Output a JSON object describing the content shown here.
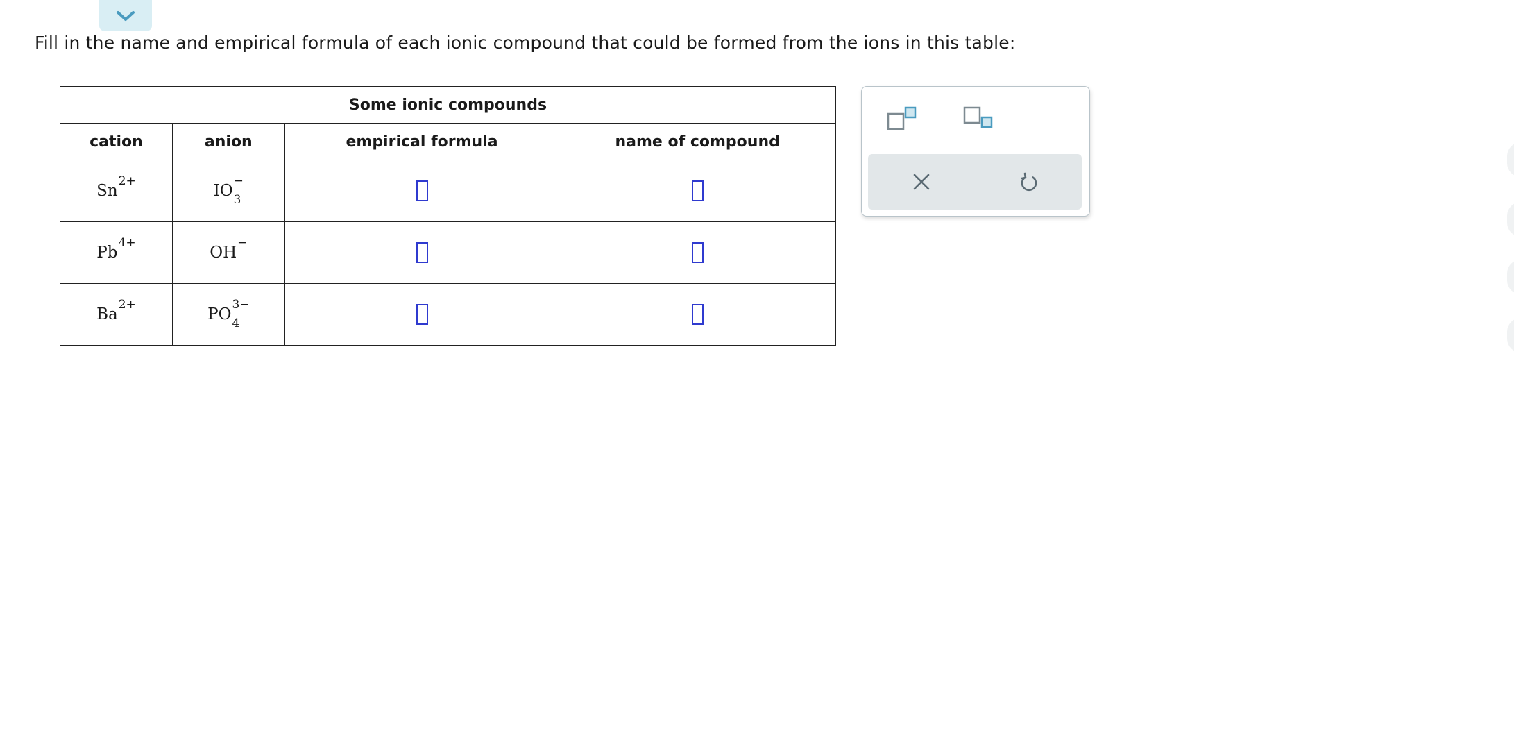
{
  "prompt": "Fill in the name and empirical formula of each ionic compound that could be formed from the ions in this table:",
  "table": {
    "caption": "Some ionic compounds",
    "headers": {
      "cation": "cation",
      "anion": "anion",
      "formula": "empirical formula",
      "name": "name of compound"
    },
    "rows": [
      {
        "cation": {
          "symbol": "Sn",
          "charge": "2+",
          "subscript": ""
        },
        "anion": {
          "symbol": "IO",
          "charge": "−",
          "subscript": "3"
        },
        "formula": "",
        "name": ""
      },
      {
        "cation": {
          "symbol": "Pb",
          "charge": "4+",
          "subscript": ""
        },
        "anion": {
          "symbol": "OH",
          "charge": "−",
          "subscript": ""
        },
        "formula": "",
        "name": ""
      },
      {
        "cation": {
          "symbol": "Ba",
          "charge": "2+",
          "subscript": ""
        },
        "anion": {
          "symbol": "PO",
          "charge": "3−",
          "subscript": "4"
        },
        "formula": "",
        "name": ""
      }
    ]
  },
  "toolbar": {
    "superscript_icon": "superscript-template-icon",
    "subscript_icon": "subscript-template-icon",
    "clear_icon": "close-icon",
    "undo_icon": "undo-icon"
  },
  "colors": {
    "input_border": "#2f3acf",
    "tool_accent": "#4a9bbf",
    "tool_gray": "#7d8a91",
    "action_bar": "#e2e7e9",
    "collapse_tab": "#d9eef4"
  }
}
